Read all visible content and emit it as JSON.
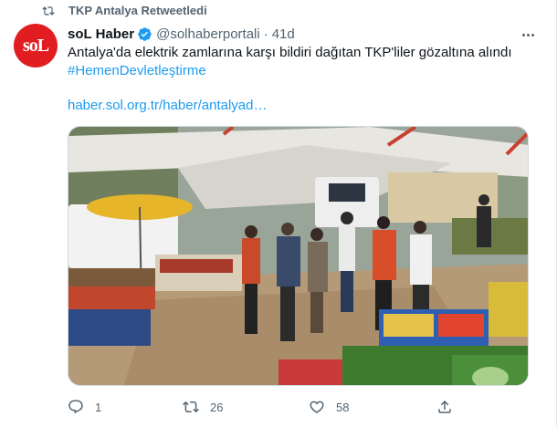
{
  "retweet": {
    "label": "TKP Antalya Retweetledi",
    "icon": "retweet-icon"
  },
  "author": {
    "name": "soL Haber",
    "handle": "@solhaberportali",
    "separator": "·",
    "time": "41d",
    "avatar_text": "soL",
    "verified": true
  },
  "tweet": {
    "text": "Antalya'da elektrik zamlarına karşı bildiri dağıtan TKP'liler gözaltına alındı",
    "hashtag": "#HemenDevletleştirme",
    "link": "haber.sol.org.tr/haber/antalyad…"
  },
  "actions": {
    "reply_count": "1",
    "retweet_count": "26",
    "like_count": "58"
  },
  "colors": {
    "accent": "#1d9bf0",
    "muted": "#536471",
    "brand_red": "#e11d21"
  }
}
